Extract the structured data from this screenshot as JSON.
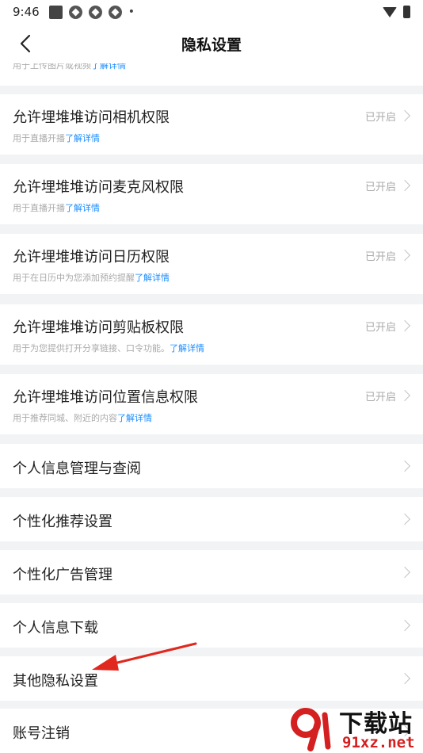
{
  "status_bar": {
    "time": "9:46",
    "dot": "•"
  },
  "header": {
    "title": "隐私设置"
  },
  "partial_row": {
    "subtitle_prefix": "用于上传图片或视频",
    "subtitle_link": "了解详情"
  },
  "permissions": [
    {
      "title": "允许埋堆堆访问相机权限",
      "subtitle_prefix": "用于直播开播",
      "subtitle_link": "了解详情",
      "status": "已开启"
    },
    {
      "title": "允许埋堆堆访问麦克风权限",
      "subtitle_prefix": "用于直播开播",
      "subtitle_link": "了解详情",
      "status": "已开启"
    },
    {
      "title": "允许埋堆堆访问日历权限",
      "subtitle_prefix": "用于在日历中为您添加预约提醒",
      "subtitle_link": "了解详情",
      "status": "已开启"
    },
    {
      "title": "允许埋堆堆访问剪贴板权限",
      "subtitle_prefix": "用于为您提供打开分享链接、口令功能。",
      "subtitle_link": "了解详情",
      "status": "已开启"
    },
    {
      "title": "允许埋堆堆访问位置信息权限",
      "subtitle_prefix": "用于推荐同城、附近的内容",
      "subtitle_link": "了解详情",
      "status": "已开启"
    }
  ],
  "menu_items": [
    {
      "label": "个人信息管理与查阅"
    },
    {
      "label": "个性化推荐设置"
    },
    {
      "label": "个性化广告管理"
    },
    {
      "label": "个人信息下载"
    },
    {
      "label": "其他隐私设置"
    },
    {
      "label": "账号注销"
    }
  ],
  "watermark": {
    "name": "下载站",
    "url": "91xz.net"
  },
  "colors": {
    "link": "#1a8cff",
    "arrow": "#e0281e",
    "background": "#f2f3f5"
  }
}
